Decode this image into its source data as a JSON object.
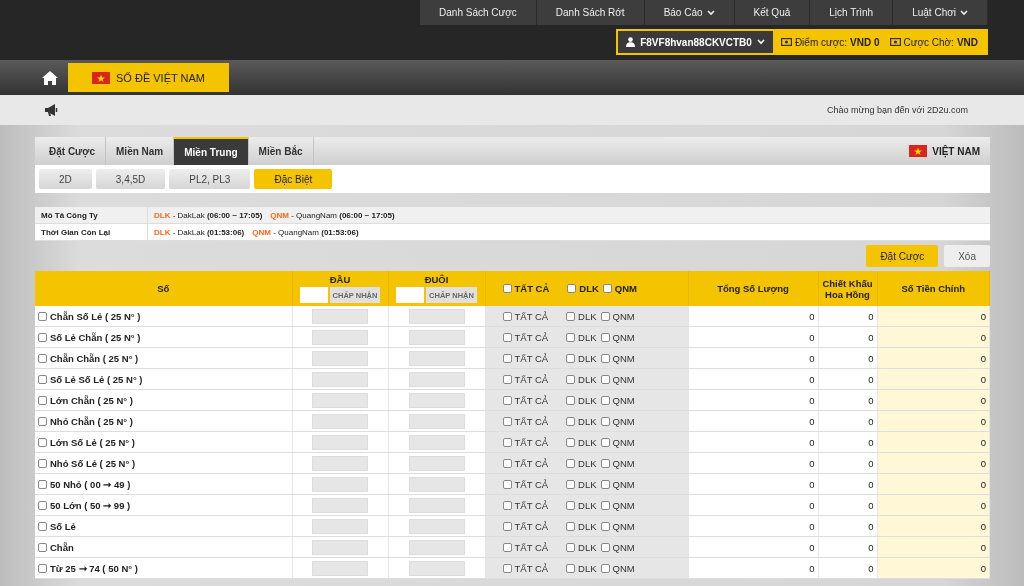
{
  "top_nav": [
    {
      "label": "Danh Sách Cược",
      "dropdown": false
    },
    {
      "label": "Danh Sách Rớt",
      "dropdown": false
    },
    {
      "label": "Báo Cáo",
      "dropdown": true
    },
    {
      "label": "Kết Quả",
      "dropdown": false
    },
    {
      "label": "Lịch Trình",
      "dropdown": false
    },
    {
      "label": "Luật Chơi",
      "dropdown": true
    }
  ],
  "account": {
    "username": "F8VF8hvan88CKVCTB0",
    "balance_label": "Điểm cược:",
    "balance": "VND 0",
    "pending_label": "Cược Chờ:",
    "pending": "VND"
  },
  "product_tab": {
    "label": "SỐ ĐỀ VIỆT NAM"
  },
  "welcome": "Chào mừng bạn đến với 2D2u.com",
  "tabs": [
    {
      "label": "Đặt Cược",
      "selected": false
    },
    {
      "label": "Miền Nam",
      "selected": false
    },
    {
      "label": "Miền Trung",
      "selected": true
    },
    {
      "label": "Miền Bắc",
      "selected": false
    }
  ],
  "region": "VIỆT NAM",
  "sub_tabs": [
    {
      "label": "2D",
      "selected": false
    },
    {
      "label": "3,4,5D",
      "selected": false
    },
    {
      "label": "PL2, PL3",
      "selected": false
    },
    {
      "label": "Đặc Biệt",
      "selected": true
    }
  ],
  "info": [
    {
      "label": "Mô Tả Công Ty",
      "items": [
        {
          "code": "DLK",
          "text": "- DakLak **(06:00 ~ 17:05)**"
        },
        {
          "code": "QNM",
          "text": "- QuangNam **(06:00 ~ 17:05)**"
        }
      ]
    },
    {
      "label": "Thời Gian Còn Lại",
      "items": [
        {
          "code": "DLK",
          "text": "- DakLak **(01:53:06)**"
        },
        {
          "code": "QNM",
          "text": "- QuangNam **(01:53:06)**"
        }
      ]
    }
  ],
  "buttons": [
    {
      "label": "Đặt Cược",
      "kind": "primary"
    },
    {
      "label": "Xóa",
      "kind": "secondary"
    }
  ],
  "table": {
    "columns": {
      "number": "Số",
      "head": "ĐẦU",
      "tail": "ĐUÔI",
      "head_accept": "CHẤP NHẬN",
      "tail_accept": "CHẤP NHẬN",
      "total": "Tổng Số Lượng",
      "commission": "Chiết Khấu Hoa Hồng",
      "amount": "Số Tiền Chính"
    },
    "header_options": [
      {
        "label": "TẤT CẢ",
        "checked": false
      },
      {
        "label": "DLK",
        "checked": false
      },
      {
        "label": "QNM",
        "checked": false
      }
    ],
    "rows": [
      {
        "label": "Chẵn Số Lẻ ( 25 N° )",
        "checked": false,
        "options": [
          {
            "label": "TẤT CẢ",
            "checked": false
          },
          {
            "label": "DLK",
            "checked": false
          },
          {
            "label": "QNM",
            "checked": false
          }
        ],
        "total": "0",
        "commission": "0",
        "amount": "0"
      },
      {
        "label": "Số Lẻ Chẵn ( 25 N° )",
        "checked": false,
        "options": [
          {
            "label": "TẤT CẢ",
            "checked": false
          },
          {
            "label": "DLK",
            "checked": false
          },
          {
            "label": "QNM",
            "checked": false
          }
        ],
        "total": "0",
        "commission": "0",
        "amount": "0"
      },
      {
        "label": "Chẵn Chẵn ( 25 N° )",
        "checked": false,
        "options": [
          {
            "label": "TẤT CẢ",
            "checked": false
          },
          {
            "label": "DLK",
            "checked": false
          },
          {
            "label": "QNM",
            "checked": false
          }
        ],
        "total": "0",
        "commission": "0",
        "amount": "0"
      },
      {
        "label": "Số Lẻ Số Lẻ ( 25 N° )",
        "checked": false,
        "options": [
          {
            "label": "TẤT CẢ",
            "checked": false
          },
          {
            "label": "DLK",
            "checked": false
          },
          {
            "label": "QNM",
            "checked": false
          }
        ],
        "total": "0",
        "commission": "0",
        "amount": "0"
      },
      {
        "label": "Lớn Chẵn ( 25 N° )",
        "checked": false,
        "options": [
          {
            "label": "TẤT CẢ",
            "checked": false
          },
          {
            "label": "DLK",
            "checked": false
          },
          {
            "label": "QNM",
            "checked": false
          }
        ],
        "total": "0",
        "commission": "0",
        "amount": "0"
      },
      {
        "label": "Nhỏ Chẵn ( 25 N° )",
        "checked": false,
        "options": [
          {
            "label": "TẤT CẢ",
            "checked": false
          },
          {
            "label": "DLK",
            "checked": false
          },
          {
            "label": "QNM",
            "checked": false
          }
        ],
        "total": "0",
        "commission": "0",
        "amount": "0"
      },
      {
        "label": "Lớn Số Lẻ ( 25 N° )",
        "checked": false,
        "options": [
          {
            "label": "TẤT CẢ",
            "checked": false
          },
          {
            "label": "DLK",
            "checked": false
          },
          {
            "label": "QNM",
            "checked": false
          }
        ],
        "total": "0",
        "commission": "0",
        "amount": "0"
      },
      {
        "label": "Nhỏ Số Lẻ ( 25 N° )",
        "checked": false,
        "options": [
          {
            "label": "TẤT CẢ",
            "checked": false
          },
          {
            "label": "DLK",
            "checked": false
          },
          {
            "label": "QNM",
            "checked": false
          }
        ],
        "total": "0",
        "commission": "0",
        "amount": "0"
      },
      {
        "label": "50 Nhỏ ( 00 ➞ 49 )",
        "checked": false,
        "options": [
          {
            "label": "TẤT CẢ",
            "checked": false
          },
          {
            "label": "DLK",
            "checked": false
          },
          {
            "label": "QNM",
            "checked": false
          }
        ],
        "total": "0",
        "commission": "0",
        "amount": "0"
      },
      {
        "label": "50 Lớn ( 50 ➞ 99 )",
        "checked": false,
        "options": [
          {
            "label": "TẤT CẢ",
            "checked": false
          },
          {
            "label": "DLK",
            "checked": false
          },
          {
            "label": "QNM",
            "checked": false
          }
        ],
        "total": "0",
        "commission": "0",
        "amount": "0"
      },
      {
        "label": "Số Lẻ",
        "checked": false,
        "options": [
          {
            "label": "TẤT CẢ",
            "checked": false
          },
          {
            "label": "DLK",
            "checked": false
          },
          {
            "label": "QNM",
            "checked": false
          }
        ],
        "total": "0",
        "commission": "0",
        "amount": "0"
      },
      {
        "label": "Chẵn",
        "checked": false,
        "options": [
          {
            "label": "TẤT CẢ",
            "checked": false
          },
          {
            "label": "DLK",
            "checked": false
          },
          {
            "label": "QNM",
            "checked": false
          }
        ],
        "total": "0",
        "commission": "0",
        "amount": "0"
      },
      {
        "label": "Từ 25 ➞ 74 ( 50 N° )",
        "checked": false,
        "options": [
          {
            "label": "TẤT CẢ",
            "checked": false
          },
          {
            "label": "DLK",
            "checked": false
          },
          {
            "label": "QNM",
            "checked": false
          }
        ],
        "total": "0",
        "commission": "0",
        "amount": "0"
      }
    ]
  }
}
